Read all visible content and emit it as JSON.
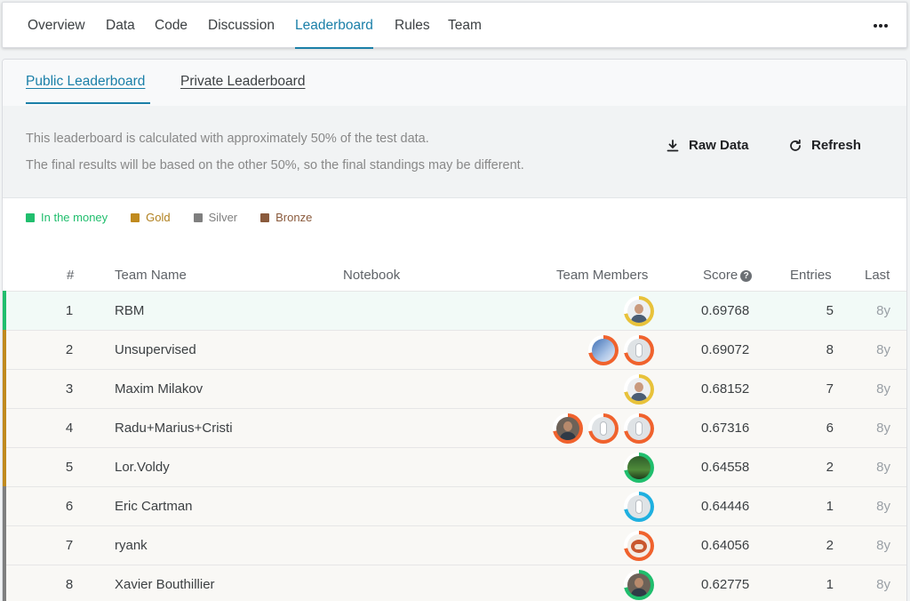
{
  "nav": {
    "tabs": [
      {
        "label": "Overview"
      },
      {
        "label": "Data"
      },
      {
        "label": "Code"
      },
      {
        "label": "Discussion"
      },
      {
        "label": "Leaderboard",
        "active": true
      },
      {
        "label": "Rules"
      },
      {
        "label": "Team"
      }
    ],
    "more_icon": "more-horizontal-icon"
  },
  "subtabs": {
    "public": "Public Leaderboard",
    "private": "Private Leaderboard"
  },
  "info": {
    "line1": "This leaderboard is calculated with approximately 50% of the test data.",
    "line2": "The final results will be based on the other 50%, so the final standings may be different.",
    "raw_data": "Raw Data",
    "refresh": "Refresh"
  },
  "legend": [
    {
      "label": "In the money",
      "color": "#20be6d"
    },
    {
      "label": "Gold",
      "color": "#c08a1e"
    },
    {
      "label": "Silver",
      "color": "#7f7f7f"
    },
    {
      "label": "Bronze",
      "color": "#8a5a3c"
    }
  ],
  "table": {
    "headers": {
      "rank": "#",
      "team": "Team Name",
      "notebook": "Notebook",
      "members": "Team Members",
      "score": "Score",
      "entries": "Entries",
      "last": "Last"
    },
    "rows": [
      {
        "rank": "1",
        "team": "RBM",
        "score": "0.69768",
        "entries": "5",
        "last": "8y",
        "bar": "#20be6d",
        "members": [
          {
            "ring": "#e8c23a",
            "style": "person-light"
          }
        ]
      },
      {
        "rank": "2",
        "team": "Unsupervised",
        "score": "0.69072",
        "entries": "8",
        "last": "8y",
        "bar": "#c08a1e",
        "members": [
          {
            "ring": "#f0622d",
            "style": "blue"
          },
          {
            "ring": "#f0622d",
            "style": "default"
          }
        ]
      },
      {
        "rank": "3",
        "team": "Maxim Milakov",
        "score": "0.68152",
        "entries": "7",
        "last": "8y",
        "bar": "#c08a1e",
        "members": [
          {
            "ring": "#e8c23a",
            "style": "person-light"
          }
        ]
      },
      {
        "rank": "4",
        "team": "Radu+Marius+Cristi",
        "score": "0.67316",
        "entries": "6",
        "last": "8y",
        "bar": "#c08a1e",
        "members": [
          {
            "ring": "#f0622d",
            "style": "person-dark"
          },
          {
            "ring": "#f0622d",
            "style": "default"
          },
          {
            "ring": "#f0622d",
            "style": "default"
          }
        ]
      },
      {
        "rank": "5",
        "team": "Lor.Voldy",
        "score": "0.64558",
        "entries": "2",
        "last": "8y",
        "bar": "#c08a1e",
        "members": [
          {
            "ring": "#20be6d",
            "style": "green"
          }
        ]
      },
      {
        "rank": "6",
        "team": "Eric Cartman",
        "score": "0.64446",
        "entries": "1",
        "last": "8y",
        "bar": "#7f7f7f",
        "members": [
          {
            "ring": "#1fb0e0",
            "style": "default"
          }
        ]
      },
      {
        "rank": "7",
        "team": "ryank",
        "score": "0.64056",
        "entries": "2",
        "last": "8y",
        "bar": "#7f7f7f",
        "members": [
          {
            "ring": "#f0622d",
            "style": "red"
          }
        ]
      },
      {
        "rank": "8",
        "team": "Xavier Bouthillier",
        "score": "0.62775",
        "entries": "1",
        "last": "8y",
        "bar": "#7f7f7f",
        "members": [
          {
            "ring": "#20be6d",
            "style": "person-dark"
          }
        ]
      }
    ]
  }
}
